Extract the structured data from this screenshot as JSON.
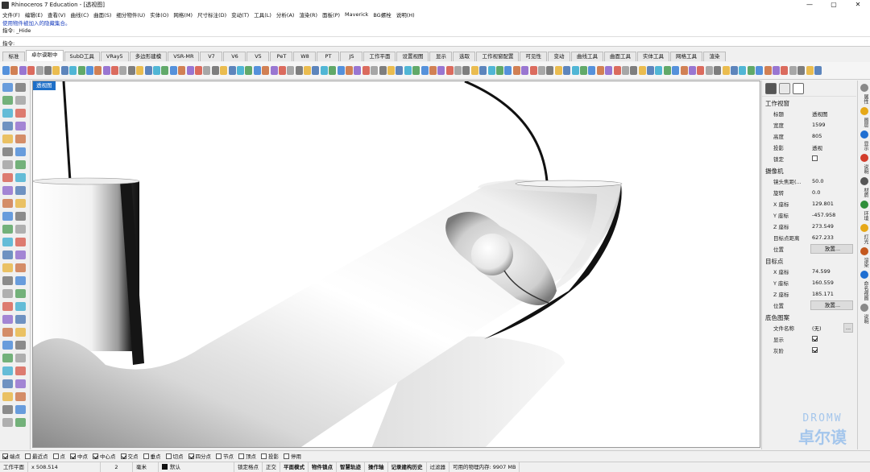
{
  "window": {
    "title": "Rhinoceros 7 Education - [透视图]",
    "controls": [
      "—",
      "▢",
      "✕"
    ]
  },
  "menu": [
    "文件(F)",
    "编辑(E)",
    "查看(V)",
    "曲线(C)",
    "曲面(S)",
    "细分物件(U)",
    "实体(O)",
    "网格(M)",
    "尺寸标注(D)",
    "变动(T)",
    "工具(L)",
    "分析(A)",
    "渲染(R)",
    "面板(P)",
    "Maverick",
    "BG螺栓",
    "说明(H)"
  ],
  "command": {
    "history_line": "使用物件被加入的隐藏集合。",
    "history_cmd": "指令: _Hide",
    "prompt": "指令:"
  },
  "toolbar_tabs": [
    "标准",
    "卓尔谟眼中",
    "SubD工具",
    "VRay5",
    "多边形建模",
    "VSR-MR",
    "V7",
    "V6",
    "V5",
    "PeT",
    "W8",
    "PT",
    "JS",
    "工作平面",
    "设置视图",
    "显示",
    "选取",
    "工作视窗配置",
    "可见性",
    "变动",
    "曲线工具",
    "曲面工具",
    "实体工具",
    "网格工具",
    "渲染"
  ],
  "active_tab_index": 1,
  "viewport": {
    "label": "透视图"
  },
  "properties": {
    "viewport_section": "工作视窗",
    "viewport_rows": [
      {
        "key": "标题",
        "value": "透视图"
      },
      {
        "key": "宽度",
        "value": "1599"
      },
      {
        "key": "高度",
        "value": "805"
      },
      {
        "key": "投影",
        "value": "透视"
      }
    ],
    "lock_label": "锁定",
    "camera_section": "摄像机",
    "camera_rows": [
      {
        "key": "镜头焦距(...",
        "value": "50.0"
      },
      {
        "key": "旋转",
        "value": "0.0"
      },
      {
        "key": "X 座标",
        "value": "129.801"
      },
      {
        "key": "Y 座标",
        "value": "-457.958"
      },
      {
        "key": "Z 座标",
        "value": "273.549"
      },
      {
        "key": "目标点距离",
        "value": "627.233"
      }
    ],
    "position_label": "位置",
    "place_button": "放置...",
    "target_section": "目标点",
    "target_rows": [
      {
        "key": "X 座标",
        "value": "74.599"
      },
      {
        "key": "Y 座标",
        "value": "160.559"
      },
      {
        "key": "Z 座标",
        "value": "185.171"
      }
    ],
    "target_position_label": "位置",
    "target_place_button": "放置...",
    "wallpaper_section": "底色图案",
    "file_name_label": "文件名称",
    "file_name_value": "(无)",
    "browse_button": "...",
    "show_label": "显示",
    "gray_label": "灰阶"
  },
  "side_tabs": [
    "属性",
    "图层",
    "显示",
    "说明",
    "材质",
    "环境",
    "灯光",
    "渲染",
    "命名视图",
    "说明"
  ],
  "osnaps": [
    {
      "label": "端点",
      "checked": true
    },
    {
      "label": "最近点",
      "checked": false
    },
    {
      "label": "点",
      "checked": false
    },
    {
      "label": "中点",
      "checked": true
    },
    {
      "label": "中心点",
      "checked": true
    },
    {
      "label": "交点",
      "checked": true
    },
    {
      "label": "垂点",
      "checked": false
    },
    {
      "label": "切点",
      "checked": false
    },
    {
      "label": "四分点",
      "checked": true
    },
    {
      "label": "节点",
      "checked": false
    },
    {
      "label": "顶点",
      "checked": false
    },
    {
      "label": "投影",
      "checked": false
    },
    {
      "label": "停用",
      "checked": false
    }
  ],
  "status": {
    "cplane": "工作平面",
    "coords": "x 508.514",
    "y": "2",
    "units": "毫米",
    "layer": "默认",
    "toggles": [
      "锁定格点",
      "正交",
      "平面模式",
      "物件锁点",
      "智慧轨迹",
      "操作轴",
      "记录建构历史",
      "过滤器"
    ],
    "memory": "可用的物理内存: 9907 MB"
  },
  "watermark": {
    "line1": "DROMW",
    "line2": "卓尔谟"
  },
  "colors": {
    "viewport_label_bg": "#1e6fc8",
    "watermark": "#96bee8"
  }
}
